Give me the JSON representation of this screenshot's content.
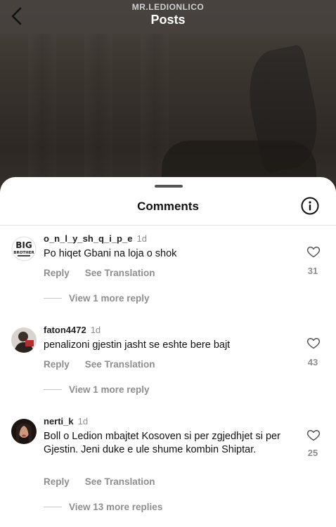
{
  "header": {
    "username": "MR.LEDIONLICO",
    "title": "Posts"
  },
  "sheet": {
    "title": "Comments"
  },
  "comments": [
    {
      "username": "o_n_l_y_sh_q_i_p_e",
      "time": "1d",
      "text": "Po hiqet  Gbani na loja  o shok",
      "reply_label": "Reply",
      "translate_label": "See Translation",
      "likes": "31",
      "more_replies": "View 1 more reply",
      "avatar": "big-brother-logo"
    },
    {
      "username": "faton4472",
      "time": "1d",
      "text": "penalizoni gjestin jasht se eshte bere  bajt",
      "reply_label": "Reply",
      "translate_label": "See Translation",
      "likes": "43",
      "more_replies": "View 1 more reply",
      "avatar": "user-photo"
    },
    {
      "username": "nerti_k",
      "time": "1d",
      "text": "Boll o Ledion mbajtet Kosoven si per zgjedhjet si per  Gjestin. Jeni duke e ule shume kombin Shiptar.",
      "reply_label": "Reply",
      "translate_label": "See Translation",
      "likes": "25",
      "more_replies": "View 13 more replies",
      "avatar": "user-photo"
    }
  ]
}
